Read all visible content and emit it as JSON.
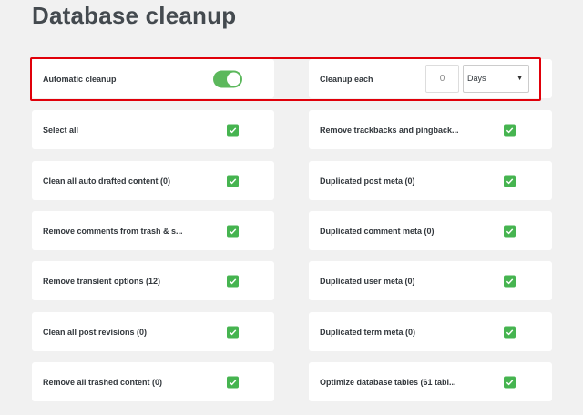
{
  "page": {
    "title": "Database cleanup"
  },
  "auto_cleanup": {
    "label": "Automatic cleanup",
    "enabled": true,
    "interval_label": "Cleanup each",
    "interval_value": "0",
    "unit_selected": "Days"
  },
  "left_items": [
    {
      "label": "Select all",
      "checked": true
    },
    {
      "label": "Clean all auto drafted content  (0)",
      "checked": true
    },
    {
      "label": "Remove comments from trash & s...",
      "checked": true
    },
    {
      "label": "Remove transient options  (12)",
      "checked": true
    },
    {
      "label": "Clean all post revisions  (0)",
      "checked": true
    },
    {
      "label": "Remove all trashed content  (0)",
      "checked": true
    }
  ],
  "right_items": [
    {
      "label": "Remove trackbacks and pingback...",
      "checked": true
    },
    {
      "label": "Duplicated post meta  (0)",
      "checked": true
    },
    {
      "label": "Duplicated comment meta  (0)",
      "checked": true
    },
    {
      "label": "Duplicated user meta  (0)",
      "checked": true
    },
    {
      "label": "Duplicated term meta  (0)",
      "checked": true
    },
    {
      "label": "Optimize database tables  (61 tabl...",
      "checked": true
    }
  ],
  "colors": {
    "accent": "#46b450",
    "toggle_on": "#5cb85c",
    "highlight": "#e0000a"
  },
  "icons": {
    "check": "check-icon",
    "dropdown": "chevron-down-icon"
  }
}
